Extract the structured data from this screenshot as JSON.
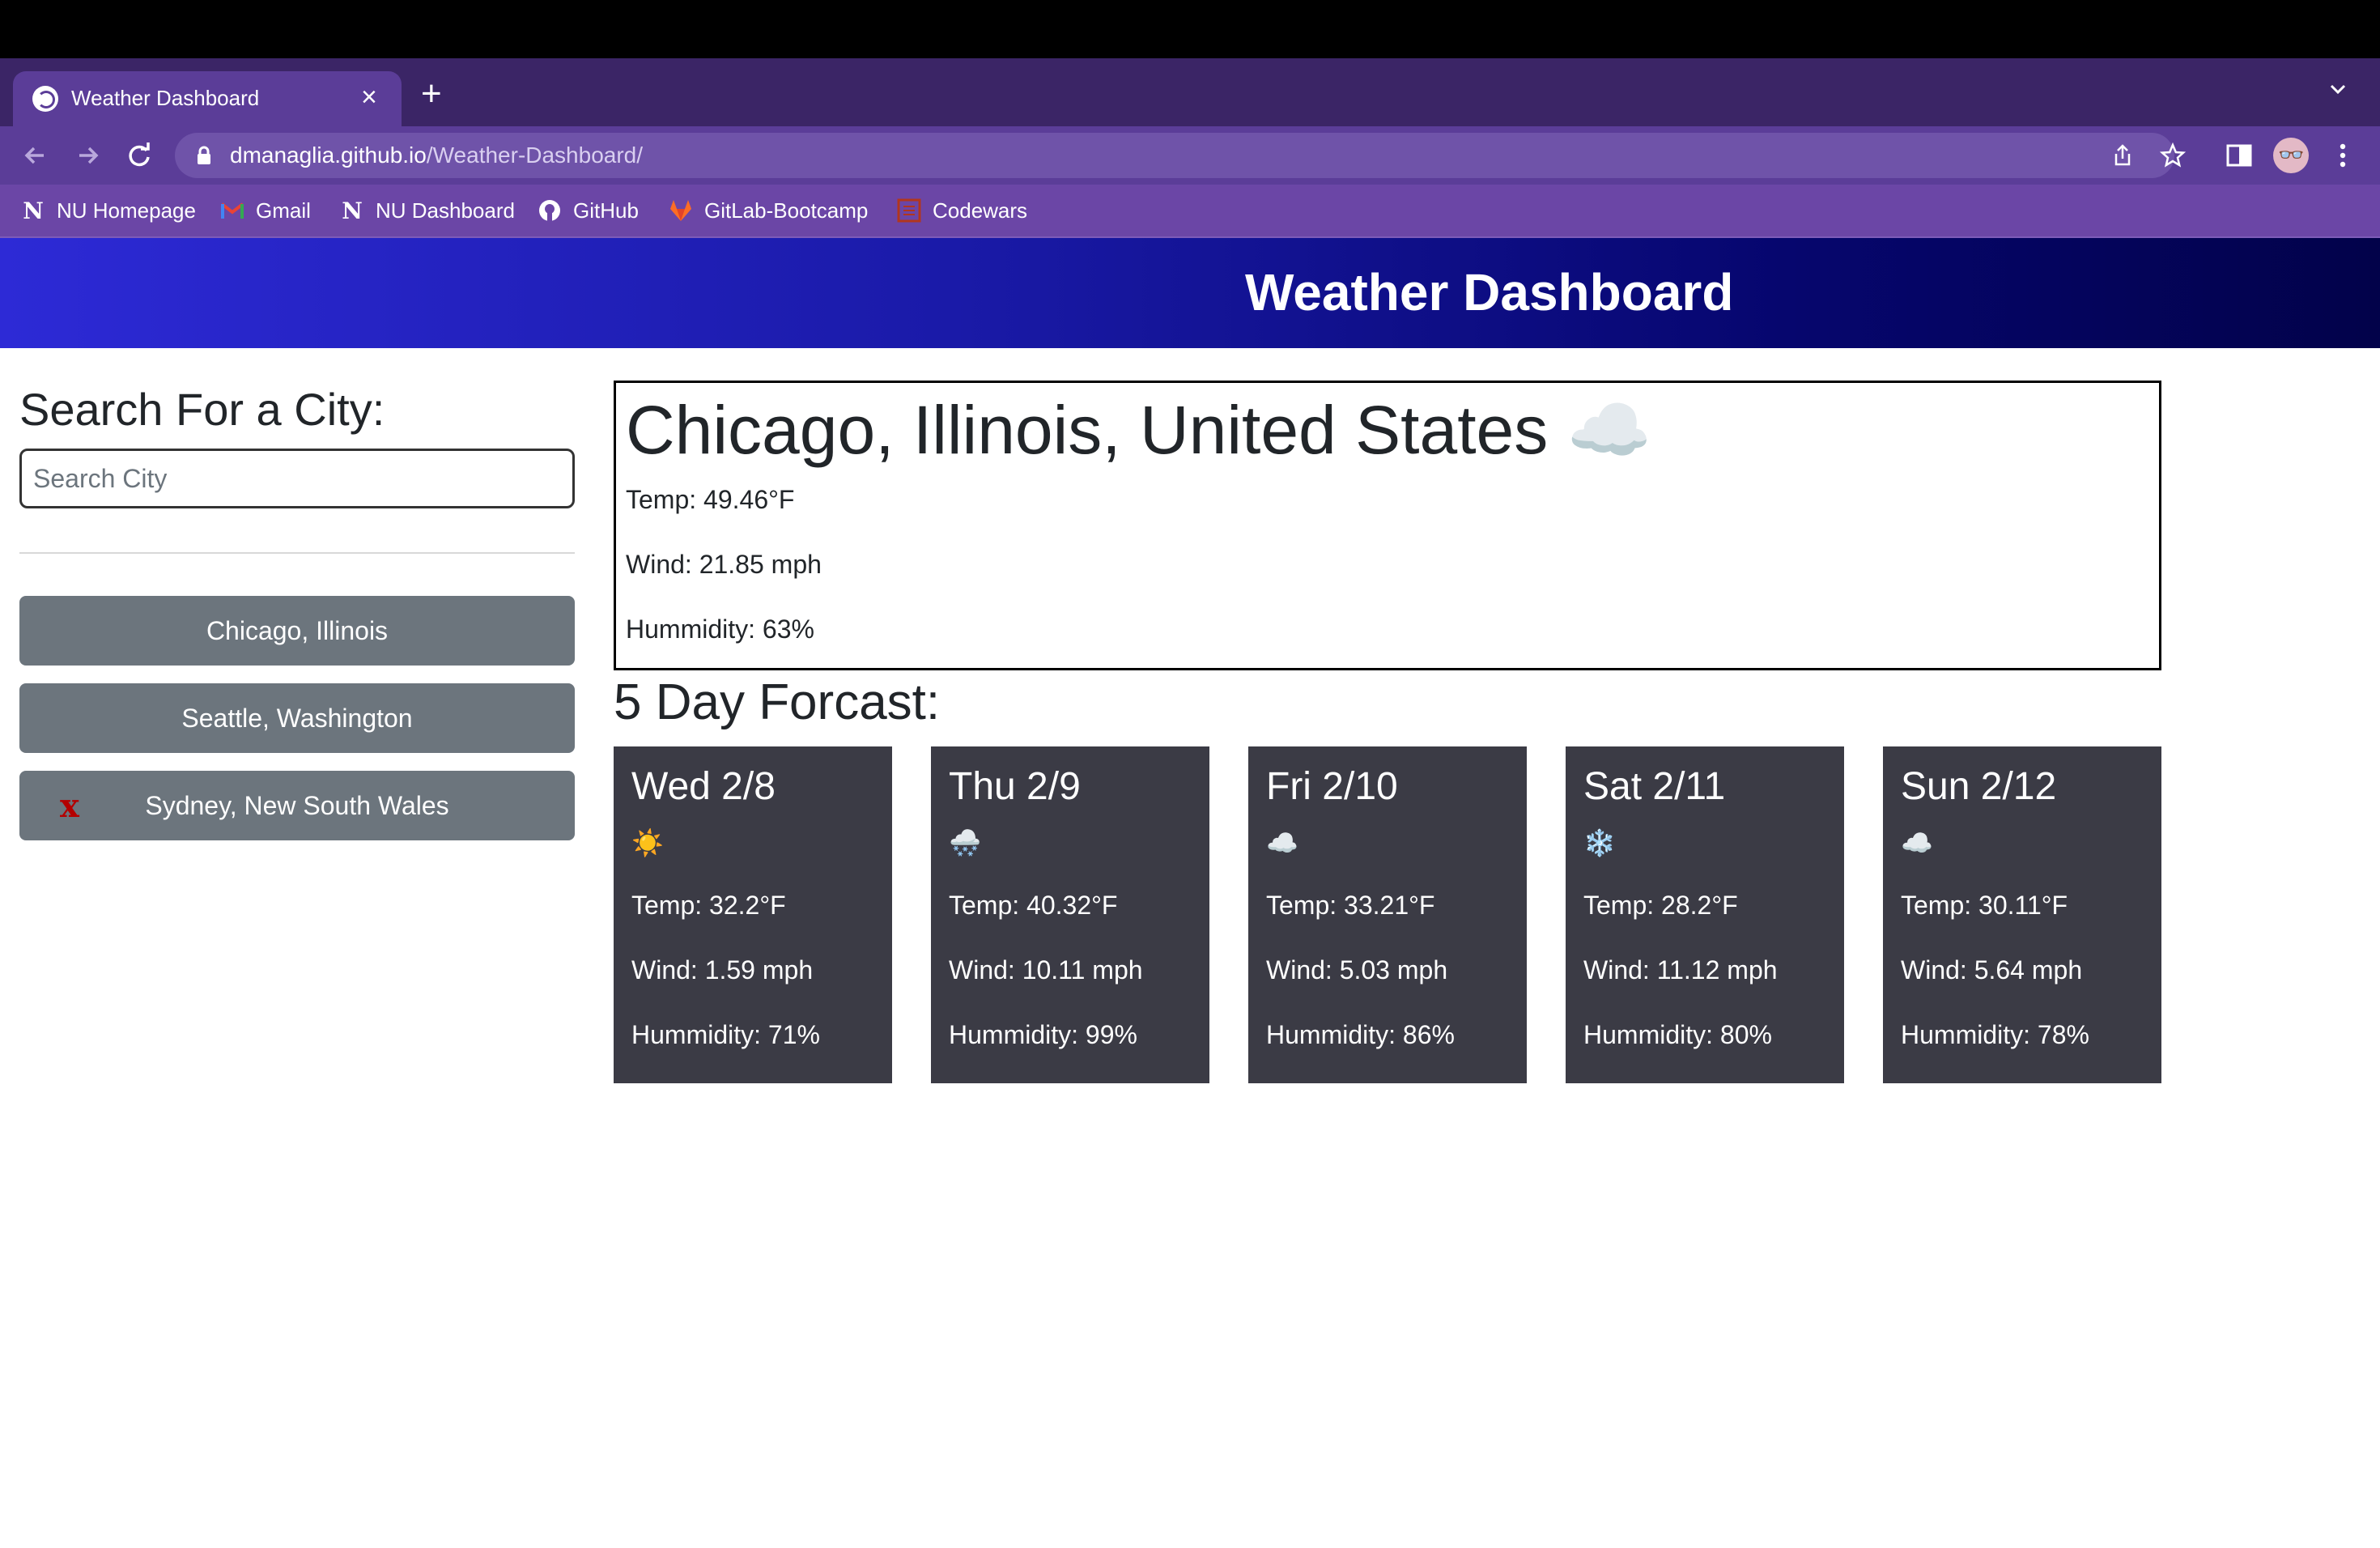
{
  "browser": {
    "tab_title": "Weather Dashboard",
    "url_host": "dmanaglia.github.io",
    "url_path": "/Weather-Dashboard/",
    "bookmarks": [
      {
        "label": "NU Homepage",
        "icon": "N"
      },
      {
        "label": "Gmail",
        "icon": "gmail-icon"
      },
      {
        "label": "NU Dashboard",
        "icon": "N"
      },
      {
        "label": "GitHub",
        "icon": "github-icon"
      },
      {
        "label": "GitLab-Bootcamp",
        "icon": "gitlab-icon"
      },
      {
        "label": "Codewars",
        "icon": "codewars-icon"
      }
    ]
  },
  "header": {
    "title": "Weather Dashboard"
  },
  "sidebar": {
    "heading": "Search For a City:",
    "search_placeholder": "Search City",
    "history": [
      {
        "label": "Chicago, Illinois"
      },
      {
        "label": "Seattle, Washington"
      },
      {
        "label": "Sydney, New South Wales",
        "mark": "x"
      }
    ]
  },
  "current": {
    "city": "Chicago, Illinois, United States",
    "icon": "☁️",
    "temp": "Temp: 49.46°F",
    "wind": "Wind: 21.85 mph",
    "humidity": "Hummidity: 63%"
  },
  "forecast": {
    "heading": "5 Day Forcast:",
    "days": [
      {
        "date": "Wed 2/8",
        "icon": "☀️",
        "temp": "Temp: 32.2°F",
        "wind": "Wind: 1.59 mph",
        "humidity": "Hummidity: 71%"
      },
      {
        "date": "Thu 2/9",
        "icon": "🌨️",
        "temp": "Temp: 40.32°F",
        "wind": "Wind: 10.11 mph",
        "humidity": "Hummidity: 99%"
      },
      {
        "date": "Fri 2/10",
        "icon": "☁️",
        "temp": "Temp: 33.21°F",
        "wind": "Wind: 5.03 mph",
        "humidity": "Hummidity: 86%"
      },
      {
        "date": "Sat 2/11",
        "icon": "❄️",
        "temp": "Temp: 28.2°F",
        "wind": "Wind: 11.12 mph",
        "humidity": "Hummidity: 80%"
      },
      {
        "date": "Sun 2/12",
        "icon": "☁️",
        "temp": "Temp: 30.11°F",
        "wind": "Wind: 5.64 mph",
        "humidity": "Hummidity: 78%"
      }
    ]
  }
}
